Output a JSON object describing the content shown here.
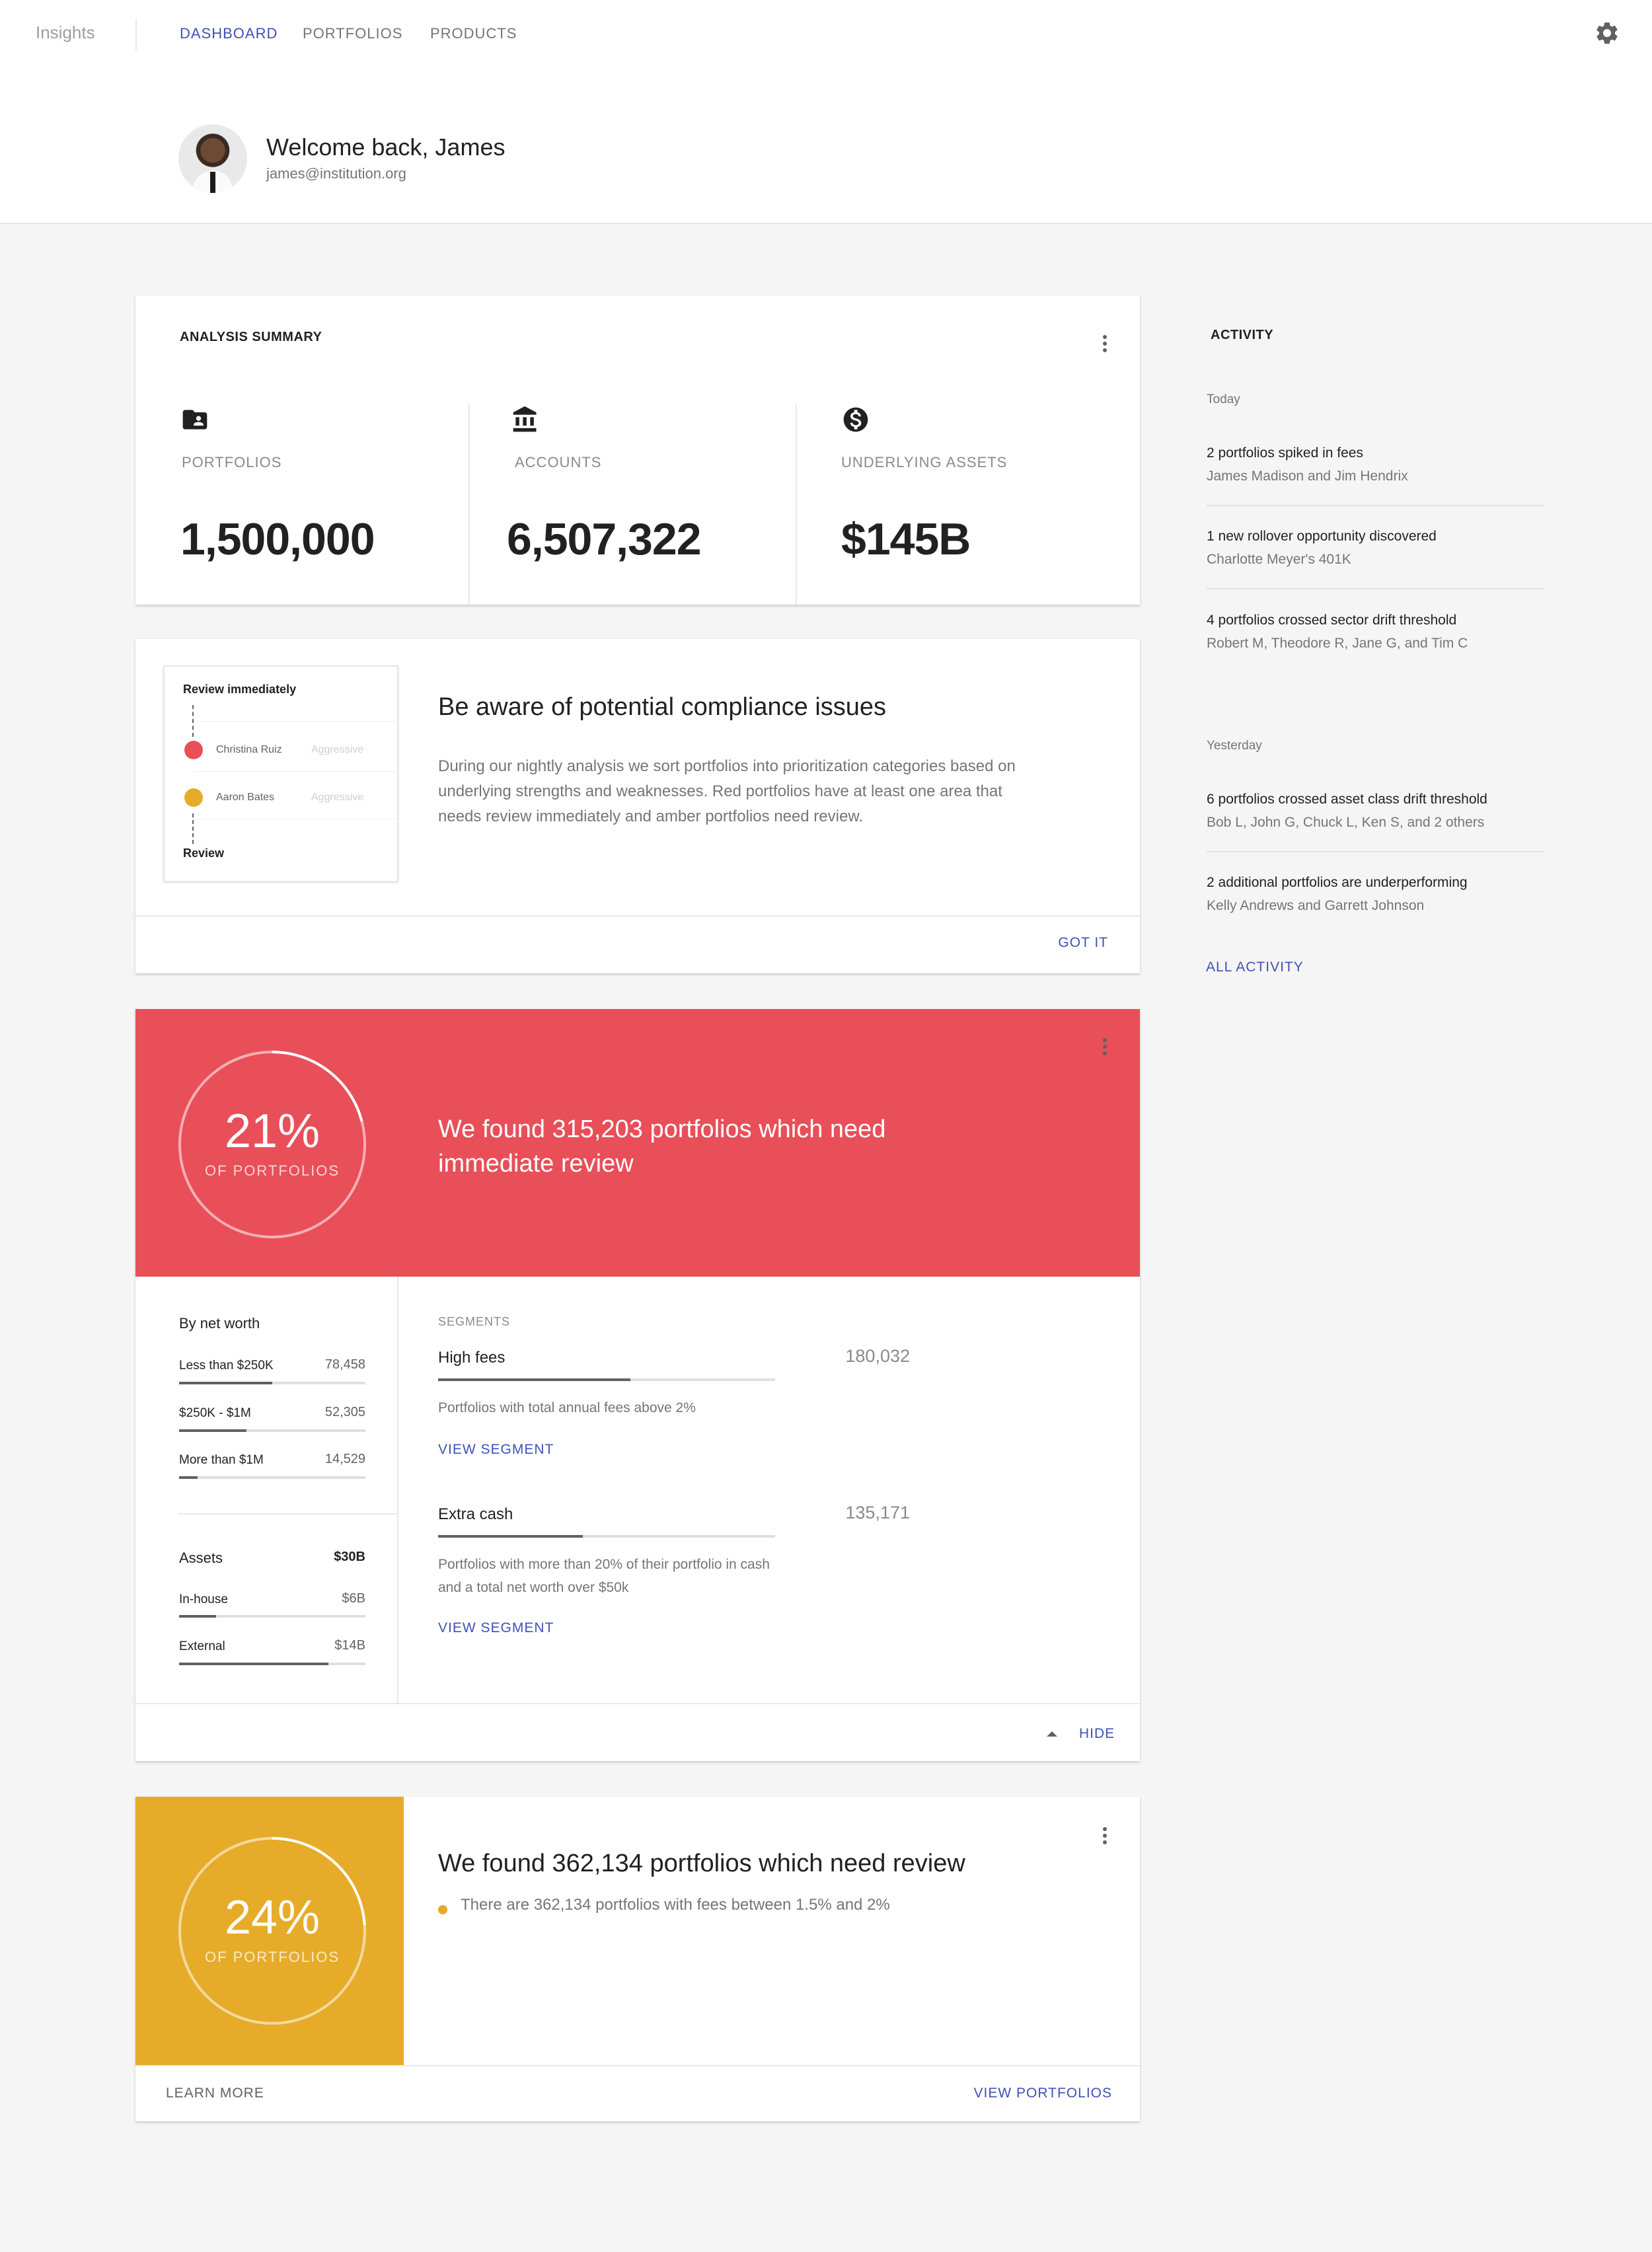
{
  "app": {
    "brand": "Insights"
  },
  "nav": {
    "dashboard": "DASHBOARD",
    "portfolios": "PORTFOLIOS",
    "products": "PRODUCTS"
  },
  "user": {
    "welcome": "Welcome back, James",
    "email": "james@institution.org"
  },
  "summary": {
    "title": "ANALYSIS SUMMARY",
    "stats": [
      {
        "label": "PORTFOLIOS",
        "value": "1,500,000",
        "icon": "portfolio-folder-icon"
      },
      {
        "label": "ACCOUNTS",
        "value": "6,507,322",
        "icon": "bank-icon"
      },
      {
        "label": "UNDERLYING ASSETS",
        "value": "$145B",
        "icon": "dollar-circle-icon"
      }
    ]
  },
  "compliance": {
    "illustration": {
      "review_immediately": "Review immediately",
      "review": "Review",
      "rows": [
        {
          "name": "Christina Ruiz",
          "tag": "Aggressive",
          "color": "#e84f59"
        },
        {
          "name": "Aaron Bates",
          "tag": "Aggressive",
          "color": "#e6ac29"
        }
      ]
    },
    "title": "Be aware of potential compliance issues",
    "body": "During our nightly analysis we sort portfolios into prioritization categories based on underlying strengths and weaknesses. Red portfolios have at least one area that needs review immediately and amber portfolios need review.",
    "action": "GOT IT"
  },
  "immediate": {
    "color": "#e84f59",
    "percent": "21%",
    "percent_label": "OF PORTFOLIOS",
    "ring_fraction": 0.21,
    "message": "We found 315,203 portfolios which need immediate review",
    "net_worth": {
      "title": "By net worth",
      "rows": [
        {
          "label": "Less than $250K",
          "value": "78,458",
          "fraction": 0.5
        },
        {
          "label": "$250K - $1M",
          "value": "52,305",
          "fraction": 0.36
        },
        {
          "label": "More than $1M",
          "value": "14,529",
          "fraction": 0.1
        }
      ]
    },
    "assets": {
      "title": "Assets",
      "total": "$30B",
      "rows": [
        {
          "label": "In-house",
          "value": "$6B",
          "fraction": 0.2
        },
        {
          "label": "External",
          "value": "$14B",
          "fraction": 0.8
        }
      ]
    },
    "segments": {
      "heading": "SEGMENTS",
      "items": [
        {
          "name": "High fees",
          "value": "180,032",
          "fraction": 0.57,
          "description": "Portfolios with total annual fees above 2%",
          "action": "VIEW SEGMENT"
        },
        {
          "name": "Extra cash",
          "value": "135,171",
          "fraction": 0.43,
          "description": "Portfolios with more than 20% of their portfolio in cash and a total net worth over $50k",
          "action": "VIEW SEGMENT"
        }
      ]
    },
    "hide": "HIDE"
  },
  "review": {
    "color": "#e6ac29",
    "percent": "24%",
    "percent_label": "OF PORTFOLIOS",
    "ring_fraction": 0.24,
    "title": "We found 362,134 portfolios which need review",
    "bullet": "There are 362,134 portfolios with fees between 1.5% and 2%",
    "learn_more": "LEARN MORE",
    "view_portfolios": "VIEW PORTFOLIOS"
  },
  "activity": {
    "title": "ACTIVITY",
    "groups": [
      {
        "day": "Today",
        "items": [
          {
            "main": "2 portfolios spiked in fees",
            "sub": "James Madison and Jim Hendrix"
          },
          {
            "main": "1 new rollover opportunity discovered",
            "sub": "Charlotte Meyer's 401K"
          },
          {
            "main": "4 portfolios crossed sector drift threshold",
            "sub": "Robert M, Theodore R, Jane G, and Tim C"
          }
        ]
      },
      {
        "day": "Yesterday",
        "items": [
          {
            "main": "6 portfolios crossed asset class drift threshold",
            "sub": "Bob L, John G, Chuck L, Ken S, and 2 others"
          },
          {
            "main": "2 additional portfolios are underperforming",
            "sub": "Kelly Andrews and Garrett Johnson"
          }
        ]
      }
    ],
    "all": "ALL ACTIVITY"
  }
}
